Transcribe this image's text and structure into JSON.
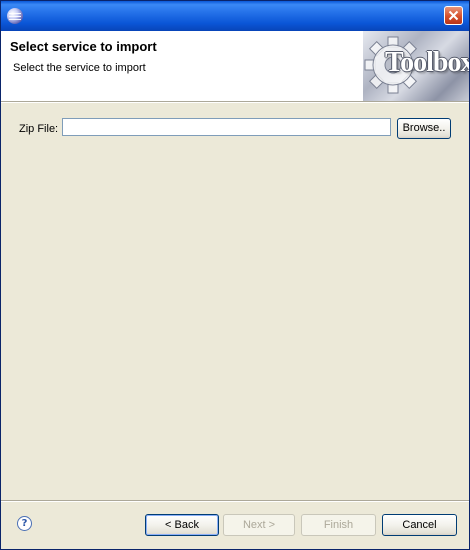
{
  "window": {
    "app_icon": "eclipse-icon",
    "close_icon": "close-icon"
  },
  "banner": {
    "title": "Select service to import",
    "message": "Select the service to import",
    "logo_text": "Toolbox"
  },
  "form": {
    "zip_label": "Zip File:",
    "zip_value": "",
    "browse_label": "Browse.."
  },
  "footer": {
    "help_icon": "help-icon",
    "help_glyph": "?",
    "back_label": "< Back",
    "next_label": "Next >",
    "finish_label": "Finish",
    "cancel_label": "Cancel",
    "next_enabled": false,
    "finish_enabled": false
  },
  "colors": {
    "titlebar": "#0a55d6",
    "dialog_bg": "#ece9d8",
    "banner_bg": "#ffffff",
    "close_button": "#d6502c"
  }
}
